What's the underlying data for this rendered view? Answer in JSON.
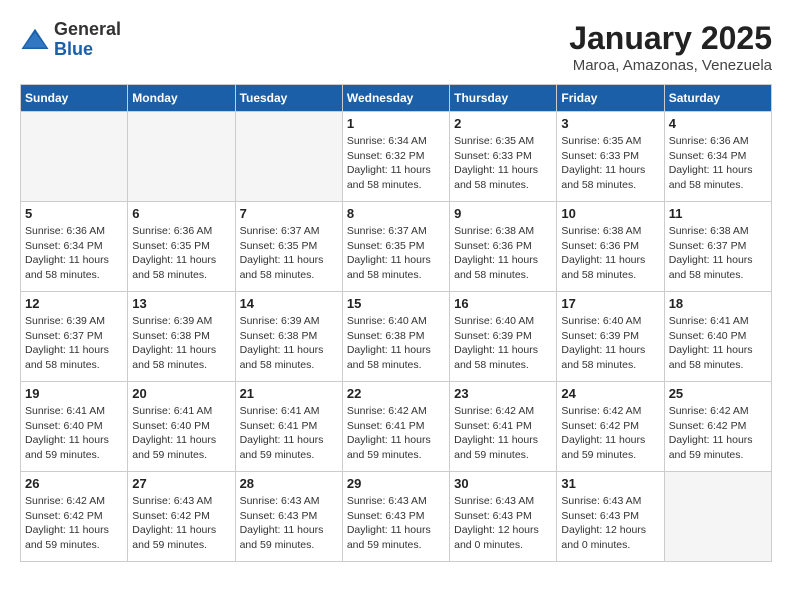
{
  "logo": {
    "general": "General",
    "blue": "Blue"
  },
  "header": {
    "month": "January 2025",
    "location": "Maroa, Amazonas, Venezuela"
  },
  "weekdays": [
    "Sunday",
    "Monday",
    "Tuesday",
    "Wednesday",
    "Thursday",
    "Friday",
    "Saturday"
  ],
  "weeks": [
    [
      {
        "day": "",
        "info": ""
      },
      {
        "day": "",
        "info": ""
      },
      {
        "day": "",
        "info": ""
      },
      {
        "day": "1",
        "info": "Sunrise: 6:34 AM\nSunset: 6:32 PM\nDaylight: 11 hours\nand 58 minutes."
      },
      {
        "day": "2",
        "info": "Sunrise: 6:35 AM\nSunset: 6:33 PM\nDaylight: 11 hours\nand 58 minutes."
      },
      {
        "day": "3",
        "info": "Sunrise: 6:35 AM\nSunset: 6:33 PM\nDaylight: 11 hours\nand 58 minutes."
      },
      {
        "day": "4",
        "info": "Sunrise: 6:36 AM\nSunset: 6:34 PM\nDaylight: 11 hours\nand 58 minutes."
      }
    ],
    [
      {
        "day": "5",
        "info": "Sunrise: 6:36 AM\nSunset: 6:34 PM\nDaylight: 11 hours\nand 58 minutes."
      },
      {
        "day": "6",
        "info": "Sunrise: 6:36 AM\nSunset: 6:35 PM\nDaylight: 11 hours\nand 58 minutes."
      },
      {
        "day": "7",
        "info": "Sunrise: 6:37 AM\nSunset: 6:35 PM\nDaylight: 11 hours\nand 58 minutes."
      },
      {
        "day": "8",
        "info": "Sunrise: 6:37 AM\nSunset: 6:35 PM\nDaylight: 11 hours\nand 58 minutes."
      },
      {
        "day": "9",
        "info": "Sunrise: 6:38 AM\nSunset: 6:36 PM\nDaylight: 11 hours\nand 58 minutes."
      },
      {
        "day": "10",
        "info": "Sunrise: 6:38 AM\nSunset: 6:36 PM\nDaylight: 11 hours\nand 58 minutes."
      },
      {
        "day": "11",
        "info": "Sunrise: 6:38 AM\nSunset: 6:37 PM\nDaylight: 11 hours\nand 58 minutes."
      }
    ],
    [
      {
        "day": "12",
        "info": "Sunrise: 6:39 AM\nSunset: 6:37 PM\nDaylight: 11 hours\nand 58 minutes."
      },
      {
        "day": "13",
        "info": "Sunrise: 6:39 AM\nSunset: 6:38 PM\nDaylight: 11 hours\nand 58 minutes."
      },
      {
        "day": "14",
        "info": "Sunrise: 6:39 AM\nSunset: 6:38 PM\nDaylight: 11 hours\nand 58 minutes."
      },
      {
        "day": "15",
        "info": "Sunrise: 6:40 AM\nSunset: 6:38 PM\nDaylight: 11 hours\nand 58 minutes."
      },
      {
        "day": "16",
        "info": "Sunrise: 6:40 AM\nSunset: 6:39 PM\nDaylight: 11 hours\nand 58 minutes."
      },
      {
        "day": "17",
        "info": "Sunrise: 6:40 AM\nSunset: 6:39 PM\nDaylight: 11 hours\nand 58 minutes."
      },
      {
        "day": "18",
        "info": "Sunrise: 6:41 AM\nSunset: 6:40 PM\nDaylight: 11 hours\nand 58 minutes."
      }
    ],
    [
      {
        "day": "19",
        "info": "Sunrise: 6:41 AM\nSunset: 6:40 PM\nDaylight: 11 hours\nand 59 minutes."
      },
      {
        "day": "20",
        "info": "Sunrise: 6:41 AM\nSunset: 6:40 PM\nDaylight: 11 hours\nand 59 minutes."
      },
      {
        "day": "21",
        "info": "Sunrise: 6:41 AM\nSunset: 6:41 PM\nDaylight: 11 hours\nand 59 minutes."
      },
      {
        "day": "22",
        "info": "Sunrise: 6:42 AM\nSunset: 6:41 PM\nDaylight: 11 hours\nand 59 minutes."
      },
      {
        "day": "23",
        "info": "Sunrise: 6:42 AM\nSunset: 6:41 PM\nDaylight: 11 hours\nand 59 minutes."
      },
      {
        "day": "24",
        "info": "Sunrise: 6:42 AM\nSunset: 6:42 PM\nDaylight: 11 hours\nand 59 minutes."
      },
      {
        "day": "25",
        "info": "Sunrise: 6:42 AM\nSunset: 6:42 PM\nDaylight: 11 hours\nand 59 minutes."
      }
    ],
    [
      {
        "day": "26",
        "info": "Sunrise: 6:42 AM\nSunset: 6:42 PM\nDaylight: 11 hours\nand 59 minutes."
      },
      {
        "day": "27",
        "info": "Sunrise: 6:43 AM\nSunset: 6:42 PM\nDaylight: 11 hours\nand 59 minutes."
      },
      {
        "day": "28",
        "info": "Sunrise: 6:43 AM\nSunset: 6:43 PM\nDaylight: 11 hours\nand 59 minutes."
      },
      {
        "day": "29",
        "info": "Sunrise: 6:43 AM\nSunset: 6:43 PM\nDaylight: 11 hours\nand 59 minutes."
      },
      {
        "day": "30",
        "info": "Sunrise: 6:43 AM\nSunset: 6:43 PM\nDaylight: 12 hours\nand 0 minutes."
      },
      {
        "day": "31",
        "info": "Sunrise: 6:43 AM\nSunset: 6:43 PM\nDaylight: 12 hours\nand 0 minutes."
      },
      {
        "day": "",
        "info": ""
      }
    ]
  ]
}
